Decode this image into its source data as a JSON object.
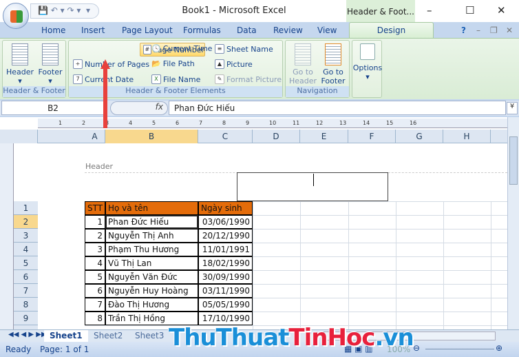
{
  "window": {
    "title": "Book1 - Microsoft Excel",
    "context_tab": "Header & Foot...",
    "controls": [
      "–",
      "☐",
      "✕"
    ]
  },
  "ribbon_tabs": [
    "Home",
    "Insert",
    "Page Layout",
    "Formulas",
    "Data",
    "Review",
    "View"
  ],
  "active_tab": "Design",
  "ribbon": {
    "header_footer": {
      "label": "Header & Footer",
      "header": "Header",
      "footer": "Footer"
    },
    "elements": {
      "label": "Header & Footer Elements",
      "page_number": "Page Number",
      "number_of_pages": "Number of Pages",
      "current_date": "Current Date",
      "current_time": "Current Time",
      "file_path": "File Path",
      "file_name": "File Name",
      "sheet_name": "Sheet Name",
      "picture": "Picture",
      "format_picture": "Format Picture"
    },
    "navigation": {
      "label": "Navigation",
      "go_header_1": "Go to",
      "go_header_2": "Header",
      "go_footer_1": "Go to",
      "go_footer_2": "Footer"
    },
    "options": {
      "label": "Options"
    }
  },
  "formula_bar": {
    "name_box": "B2",
    "fx": "fx",
    "value": "Phan Đức Hiếu"
  },
  "columns": [
    "A",
    "B",
    "C",
    "D",
    "E",
    "F",
    "G",
    "H"
  ],
  "ruler_marks": [
    "1",
    "2",
    "3",
    "4",
    "5",
    "6",
    "7",
    "8",
    "9",
    "10",
    "11",
    "12",
    "13",
    "14",
    "15",
    "16"
  ],
  "header_area_label": "Header",
  "table": {
    "headers": [
      "STT",
      "Họ và tên",
      "Ngày sinh"
    ],
    "header_color": "#e46c0a",
    "rows": [
      [
        "1",
        "Phan Đức Hiếu",
        "03/06/1990"
      ],
      [
        "2",
        "Nguyễn Thị Anh",
        "20/12/1990"
      ],
      [
        "3",
        "Phạm Thu Hương",
        "11/01/1991"
      ],
      [
        "4",
        "Vũ Thị Lan",
        "18/02/1990"
      ],
      [
        "5",
        "Nguyễn Văn Đức",
        "30/09/1990"
      ],
      [
        "6",
        "Nguyễn Huy Hoàng",
        "03/11/1990"
      ],
      [
        "7",
        "Đào Thị Hương",
        "05/05/1990"
      ],
      [
        "8",
        "Trần Thị Hồng",
        "17/10/1990"
      ]
    ]
  },
  "row_numbers": [
    "1",
    "2",
    "3",
    "4",
    "5",
    "6",
    "7",
    "8",
    "9"
  ],
  "sheets": [
    "Sheet1",
    "Sheet2",
    "Sheet3"
  ],
  "active_sheet": "Sheet1",
  "status": {
    "ready": "Ready",
    "page": "Page: 1 of 1",
    "zoom": "100%"
  },
  "watermark": {
    "part1": "ThuThuat",
    "part2": "TinHoc",
    "part3": ".vn"
  }
}
